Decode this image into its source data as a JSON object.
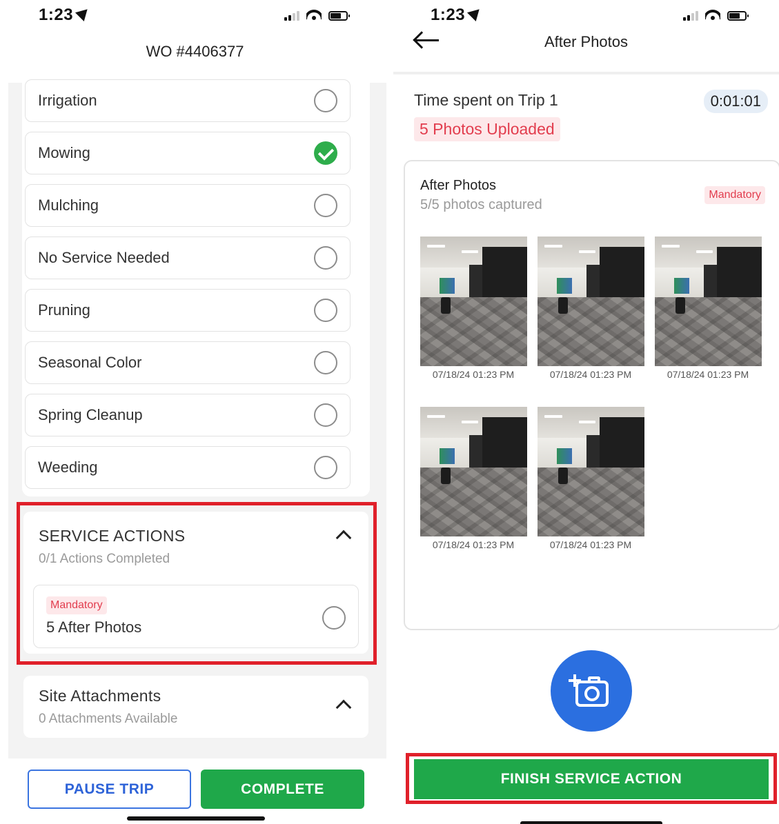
{
  "left": {
    "status": {
      "time": "1:23"
    },
    "header": {
      "title": "WO #4406377"
    },
    "services": [
      {
        "label": "Irrigation",
        "checked": false
      },
      {
        "label": "Mowing",
        "checked": true
      },
      {
        "label": "Mulching",
        "checked": false
      },
      {
        "label": "No Service Needed",
        "checked": false
      },
      {
        "label": "Pruning",
        "checked": false
      },
      {
        "label": "Seasonal Color",
        "checked": false
      },
      {
        "label": "Spring Cleanup",
        "checked": false
      },
      {
        "label": "Weeding",
        "checked": false
      }
    ],
    "service_actions": {
      "title": "SERVICE ACTIONS",
      "subtitle": "0/1 Actions Completed",
      "item": {
        "badge": "Mandatory",
        "label": "5 After Photos",
        "checked": false
      }
    },
    "site_attachments": {
      "title": "Site Attachments",
      "subtitle": "0 Attachments Available"
    },
    "buttons": {
      "pause": "PAUSE TRIP",
      "complete": "COMPLETE"
    }
  },
  "right": {
    "status": {
      "time": "1:23"
    },
    "header": {
      "title": "After Photos"
    },
    "trip": {
      "label": "Time spent on Trip 1",
      "duration": "0:01:01",
      "uploaded": "5 Photos Uploaded"
    },
    "photo_card": {
      "title": "After Photos",
      "subtitle": "5/5 photos captured",
      "badge": "Mandatory",
      "timestamps": [
        "07/18/24 01:23 PM",
        "07/18/24 01:23 PM",
        "07/18/24 01:23 PM",
        "07/18/24 01:23 PM",
        "07/18/24 01:23 PM"
      ]
    },
    "camera_icon": "add-photo-icon",
    "finish_button": "FINISH SERVICE ACTION"
  },
  "colors": {
    "accent_green": "#1fa84a",
    "accent_blue": "#2b6fe0",
    "mandatory_red": "#e23d4e",
    "highlight_red": "#e0202a"
  }
}
